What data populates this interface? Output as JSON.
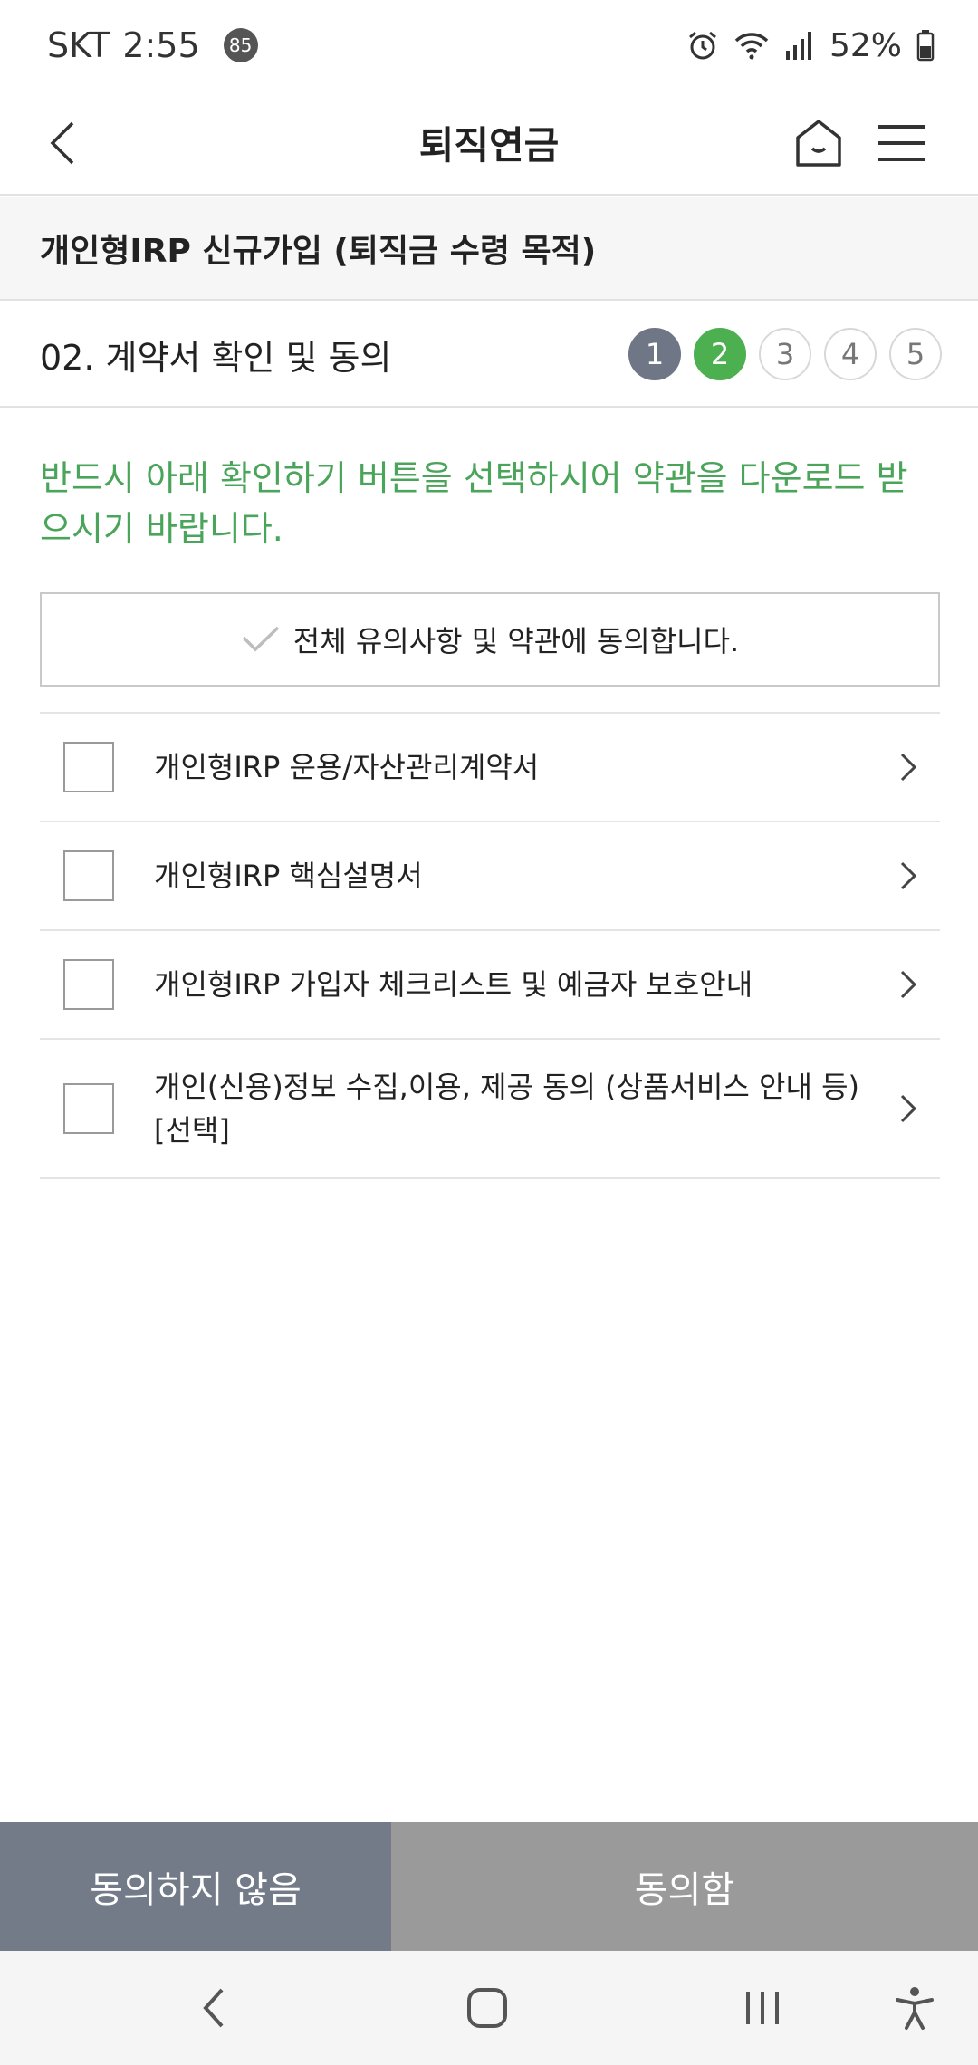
{
  "status_bar": {
    "carrier": "SKT",
    "time": "2:55",
    "notification_count": "85",
    "battery": "52%"
  },
  "header": {
    "title": "퇴직연금"
  },
  "section": {
    "title": "개인형IRP 신규가입 (퇴직금 수령 목적)"
  },
  "step_bar": {
    "title": "02. 계약서 확인 및 동의",
    "steps": [
      "1",
      "2",
      "3",
      "4",
      "5"
    ],
    "current_step": 2
  },
  "notice": {
    "text": "반드시 아래 확인하기 버튼을 선택하시어 약관을 다운로드 받으시기 바랍니다."
  },
  "agree_all": {
    "label": "전체 유의사항 및 약관에 동의합니다."
  },
  "agreements": [
    {
      "label": "개인형IRP 운용/자산관리계약서"
    },
    {
      "label": "개인형IRP 핵심설명서"
    },
    {
      "label": "개인형IRP 가입자 체크리스트 및 예금자 보호안내"
    },
    {
      "label": "개인(신용)정보 수집,이용, 제공 동의 (상품서비스 안내 등) [선택]"
    }
  ],
  "buttons": {
    "disagree": "동의하지 않음",
    "agree": "동의함"
  },
  "colors": {
    "accent_green": "#4caf50",
    "notice_green": "#4aa55a",
    "step_done": "#6f7686",
    "disagree_bg": "#737b88",
    "agree_bg": "#9a9a9a"
  }
}
